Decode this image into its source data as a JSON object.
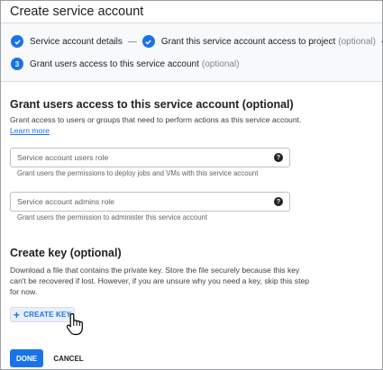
{
  "dialog": {
    "title": "Create service account"
  },
  "stepper": {
    "step1": {
      "label": "Service account details"
    },
    "step2": {
      "label": "Grant this service account access to project",
      "optional": "(optional)"
    },
    "step3": {
      "number": "3",
      "label": "Grant users access to this service account",
      "optional": "(optional)"
    }
  },
  "grant_section": {
    "heading": "Grant users access to this service account (optional)",
    "description": "Grant access to users or groups that need to perform actions as this service account.",
    "learn_more": "Learn more",
    "users_role": {
      "placeholder": "Service account users role",
      "hint": "Grant users the permissions to deploy jobs and VMs with this service account"
    },
    "admins_role": {
      "placeholder": "Service account admins role",
      "hint": "Grant users the permission to administer this service account"
    },
    "help_glyph": "?"
  },
  "key_section": {
    "heading": "Create key (optional)",
    "description_line1": "Download a file that contains the private key. Store the file securely because this key",
    "description_line2": "can't be recovered if lost. However, if you are unsure why you need a key, skip this step",
    "description_line3": "for now.",
    "create_button": "CREATE KEY"
  },
  "footer": {
    "done": "DONE",
    "cancel": "CANCEL"
  },
  "colors": {
    "accent": "#1a73e8",
    "stepper_bg": "#f8f9fa",
    "border": "#dadce0"
  },
  "icons": {
    "check": "check-circle-icon",
    "plus": "plus-icon",
    "cursor": "hand-pointer-icon",
    "help": "help-circle-icon"
  }
}
